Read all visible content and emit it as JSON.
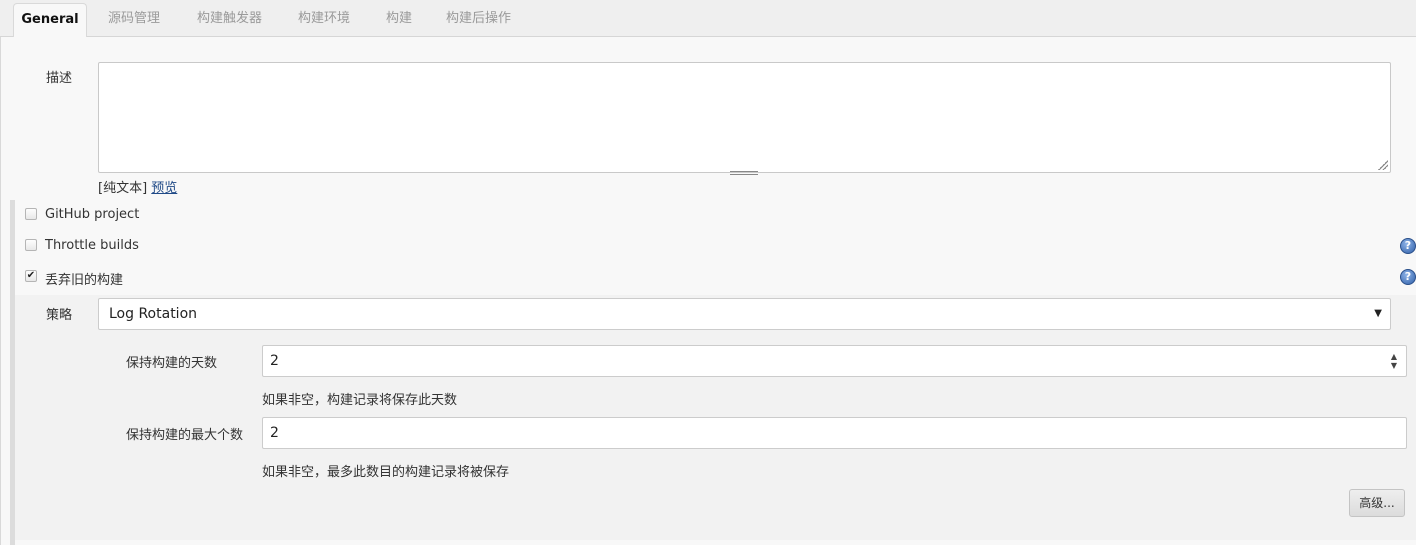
{
  "tabs": [
    {
      "label": "General",
      "active": true
    },
    {
      "label": "源码管理",
      "active": false
    },
    {
      "label": "构建触发器",
      "active": false
    },
    {
      "label": "构建环境",
      "active": false
    },
    {
      "label": "构建",
      "active": false
    },
    {
      "label": "构建后操作",
      "active": false
    }
  ],
  "description": {
    "label": "描述",
    "value": "",
    "format_label": "[纯文本]",
    "preview_link": "预览"
  },
  "options": [
    {
      "label": "GitHub project",
      "checked": false,
      "help": false
    },
    {
      "label": "Throttle builds",
      "checked": false,
      "help": true
    },
    {
      "label": "丢弃旧的构建",
      "checked": true,
      "help": true
    }
  ],
  "discard": {
    "strategy_label": "策略",
    "strategy_value": "Log Rotation",
    "days_label": "保持构建的天数",
    "days_value": "2",
    "days_hint": "如果非空，构建记录将保存此天数",
    "max_label": "保持构建的最大个数",
    "max_value": "2",
    "max_hint": "如果非空，最多此数目的构建记录将被保存",
    "advanced_button": "高级..."
  },
  "icons": {
    "checkmark": "✔",
    "help": "?",
    "dropdown": "▼",
    "spinner_up": "▲",
    "spinner_down": "▼"
  }
}
